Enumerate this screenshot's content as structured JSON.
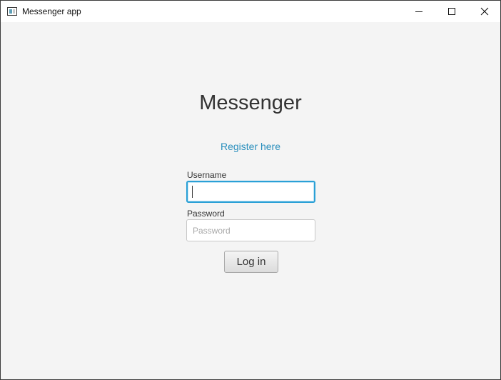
{
  "window": {
    "title": "Messenger app",
    "controls": {
      "minimize_icon": "minimize-icon",
      "maximize_icon": "maximize-icon",
      "close_icon": "close-icon"
    }
  },
  "main": {
    "heading": "Messenger",
    "register_link": "Register here",
    "username": {
      "label": "Username",
      "value": "",
      "placeholder": ""
    },
    "password": {
      "label": "Password",
      "value": "",
      "placeholder": "Password"
    },
    "login_button": "Log in"
  },
  "colors": {
    "link": "#2a8fbd",
    "focus": "#2aa0d6",
    "background": "#f4f4f4"
  }
}
